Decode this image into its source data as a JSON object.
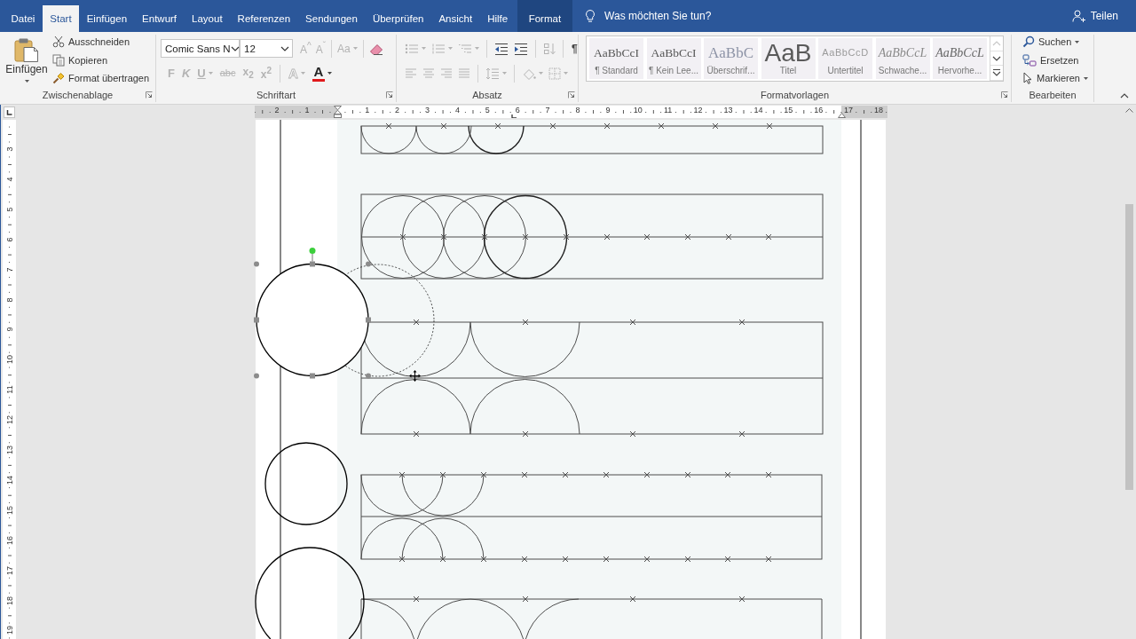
{
  "tabs": [
    {
      "label": "Datei",
      "selected": false,
      "kind": "standard"
    },
    {
      "label": "Start",
      "selected": true,
      "kind": "standard"
    },
    {
      "label": "Einfügen",
      "selected": false,
      "kind": "standard"
    },
    {
      "label": "Entwurf",
      "selected": false,
      "kind": "standard"
    },
    {
      "label": "Layout",
      "selected": false,
      "kind": "standard"
    },
    {
      "label": "Referenzen",
      "selected": false,
      "kind": "standard"
    },
    {
      "label": "Sendungen",
      "selected": false,
      "kind": "standard"
    },
    {
      "label": "Überprüfen",
      "selected": false,
      "kind": "standard"
    },
    {
      "label": "Ansicht",
      "selected": false,
      "kind": "standard"
    },
    {
      "label": "Hilfe",
      "selected": false,
      "kind": "standard"
    },
    {
      "label": "Format",
      "selected": false,
      "kind": "contextual"
    }
  ],
  "tell_me": {
    "placeholder": "Was möchten Sie tun?"
  },
  "share": {
    "label": "Teilen"
  },
  "clipboard": {
    "title": "Zwischenablage",
    "paste": {
      "label": "Einfügen"
    },
    "commands": [
      {
        "label": "Ausschneiden"
      },
      {
        "label": "Kopieren"
      },
      {
        "label": "Format übertragen"
      }
    ]
  },
  "font": {
    "title": "Schriftart",
    "font_name": "Comic Sans N",
    "font_size": "12",
    "size_buttons": [
      {
        "label": "A$^{^}$",
        "disabled": true
      },
      {
        "label": "A$^{ˇ}$",
        "disabled": true
      }
    ],
    "case_button": {
      "label": "Aa",
      "disabled": true,
      "dropdown": true
    },
    "clear_button": {
      "disabled": false
    },
    "style_buttons": [
      {
        "label": "F",
        "kind": "bold",
        "disabled": true,
        "dropdown": false
      },
      {
        "label": "K",
        "kind": "italic",
        "disabled": true,
        "dropdown": false
      },
      {
        "label": "U",
        "kind": "underline",
        "disabled": true,
        "dropdown": true
      },
      {
        "label": "abc",
        "kind": "strike",
        "disabled": true,
        "dropdown": false
      },
      {
        "label": "x$_{2}$",
        "kind": "plain",
        "disabled": true,
        "dropdown": false
      },
      {
        "label": "x$^{2}$",
        "kind": "plain",
        "disabled": true,
        "dropdown": false
      }
    ],
    "effect_buttons": [
      {
        "label": "A",
        "kind": "outline",
        "disabled": true,
        "dropdown": true
      },
      {
        "label": "A",
        "kind": "color",
        "disabled": false,
        "dropdown": true
      }
    ]
  },
  "paragraph": {
    "title": "Absatz",
    "list_buttons": [
      {
        "disabled": true,
        "dropdown": true
      },
      {
        "disabled": true,
        "dropdown": true
      },
      {
        "disabled": true,
        "dropdown": true
      }
    ],
    "indent_buttons": [
      {
        "disabled": false
      },
      {
        "disabled": false
      }
    ],
    "sort_button": {
      "disabled": true
    },
    "marks_button": {
      "label": "¶",
      "disabled": false
    },
    "align_buttons": [
      {
        "disabled": true
      },
      {
        "disabled": true
      },
      {
        "disabled": true
      },
      {
        "disabled": true
      }
    ],
    "spacing_button": {
      "disabled": true,
      "dropdown": true
    },
    "fill_buttons": [
      {
        "disabled": true,
        "dropdown": true
      },
      {
        "disabled": true,
        "dropdown": true
      }
    ]
  },
  "styles": {
    "title": "Formatvorlagen",
    "items": [
      {
        "preview": "AaBbCcI",
        "name": "¶ Standard",
        "kind": "body",
        "selected": false
      },
      {
        "preview": "AaBbCcI",
        "name": "¶ Kein Lee...",
        "kind": "body",
        "selected": false
      },
      {
        "preview": "AaBbC",
        "name": "Überschrif...",
        "kind": "heading",
        "selected": false
      },
      {
        "preview": "AaB",
        "name": "Titel",
        "kind": "title",
        "selected": false
      },
      {
        "preview": "AaBbCcD",
        "name": "Untertitel",
        "kind": "subtitle",
        "selected": false
      },
      {
        "preview": "AaBbCcL",
        "name": "Schwache...",
        "kind": "subtle",
        "selected": false
      },
      {
        "preview": "AaBbCcL",
        "name": "Hervorhe...",
        "kind": "emphasis",
        "selected": false
      }
    ],
    "scroll_buttons": [
      {
        "disabled": true
      },
      {
        "disabled": false
      },
      {
        "disabled": false
      }
    ]
  },
  "editing": {
    "title": "Bearbeiten",
    "commands": [
      {
        "label": "Suchen",
        "dropdown": true
      },
      {
        "label": "Ersetzen",
        "dropdown": false
      },
      {
        "label": "Markieren",
        "dropdown": true
      }
    ]
  },
  "ruler": {
    "horizontal": [
      "2",
      "1",
      "1",
      "2",
      "3",
      "4",
      "5",
      "6",
      "7",
      "8",
      "9",
      "10",
      "11",
      "12",
      "13",
      "14",
      "15",
      "16",
      "17",
      "18"
    ],
    "vertical": [
      "3",
      "4",
      "5",
      "6",
      "7",
      "8",
      "9",
      "10",
      "11",
      "12",
      "13",
      "14",
      "15",
      "16",
      "17",
      "18",
      "19"
    ]
  },
  "document": {
    "shapes": [
      {
        "selected": true,
        "dragging": true
      },
      {
        "selected": false,
        "dragging": false
      },
      {
        "selected": false,
        "dragging": false
      }
    ]
  }
}
